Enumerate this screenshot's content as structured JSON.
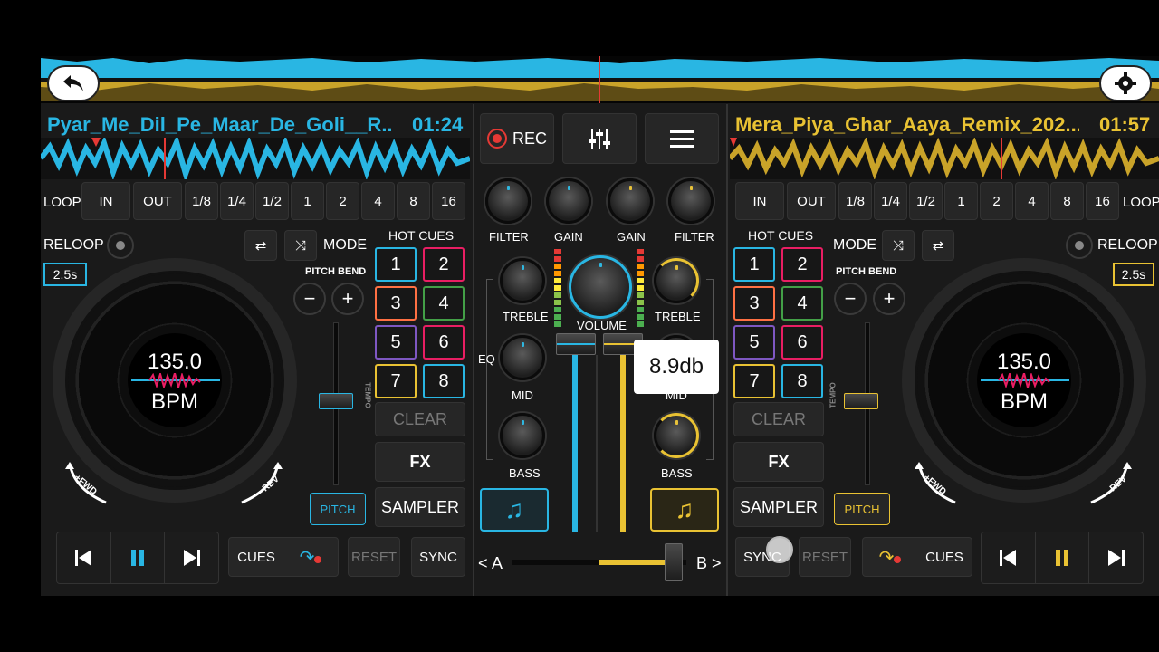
{
  "colors": {
    "deckA": "#29b6e3",
    "deckB": "#e9c233",
    "bg": "#1a1a1a"
  },
  "overview": {
    "back_icon": "back-arrow-icon",
    "settings_icon": "gear-icon"
  },
  "deckA": {
    "title": "Pyar_Me_Dil_Pe_Maar_De_Goli__R...",
    "time": "01:24",
    "loop_label": "LOOP",
    "loop_buttons": [
      "IN",
      "OUT",
      "1/8",
      "1/4",
      "1/2",
      "1",
      "2",
      "4",
      "8",
      "16"
    ],
    "reloop": "RELOOP",
    "loop_len": "2.5s",
    "mode": "MODE",
    "pitch_bend": "PITCH BEND",
    "hot_cues": "HOT CUES",
    "cues": [
      "1",
      "2",
      "3",
      "4",
      "5",
      "6",
      "7",
      "8"
    ],
    "clear": "CLEAR",
    "fx": "FX",
    "sampler": "SAMPLER",
    "pitch": "PITCH",
    "tempo": "TEMPO",
    "bpm_value": "135.0",
    "bpm_unit": "BPM",
    "fwd": "+FWD",
    "rev": "-REV",
    "cues_btn": "CUES",
    "reset": "RESET",
    "sync": "SYNC",
    "minus": "−",
    "plus": "+"
  },
  "deckB": {
    "title": "Mera_Piya_Ghar_Aaya_Remix_202...",
    "time": "01:57",
    "loop_label": "LOOP",
    "loop_buttons": [
      "IN",
      "OUT",
      "1/8",
      "1/4",
      "1/2",
      "1",
      "2",
      "4",
      "8",
      "16"
    ],
    "reloop": "RELOOP",
    "loop_len": "2.5s",
    "mode": "MODE",
    "pitch_bend": "PITCH BEND",
    "hot_cues": "HOT CUES",
    "cues": [
      "1",
      "2",
      "3",
      "4",
      "5",
      "6",
      "7",
      "8"
    ],
    "clear": "CLEAR",
    "fx": "FX",
    "sampler": "SAMPLER",
    "pitch": "PITCH",
    "tempo": "TEMPO",
    "bpm_value": "135.0",
    "bpm_unit": "BPM",
    "fwd": "+FWD",
    "rev": "-REV",
    "cues_btn": "CUES",
    "reset": "RESET",
    "sync": "SYNC",
    "minus": "−",
    "plus": "+"
  },
  "mixer": {
    "rec": "REC",
    "filter": "FILTER",
    "gain": "GAIN",
    "treble": "TREBLE",
    "volume": "VOLUME",
    "eq": "EQ",
    "mid": "MID",
    "bass": "BASS",
    "tooltip": "8.9db",
    "xfader_a": "A",
    "xfader_b": "B",
    "xfader_left": "<",
    "xfader_right": ">"
  }
}
